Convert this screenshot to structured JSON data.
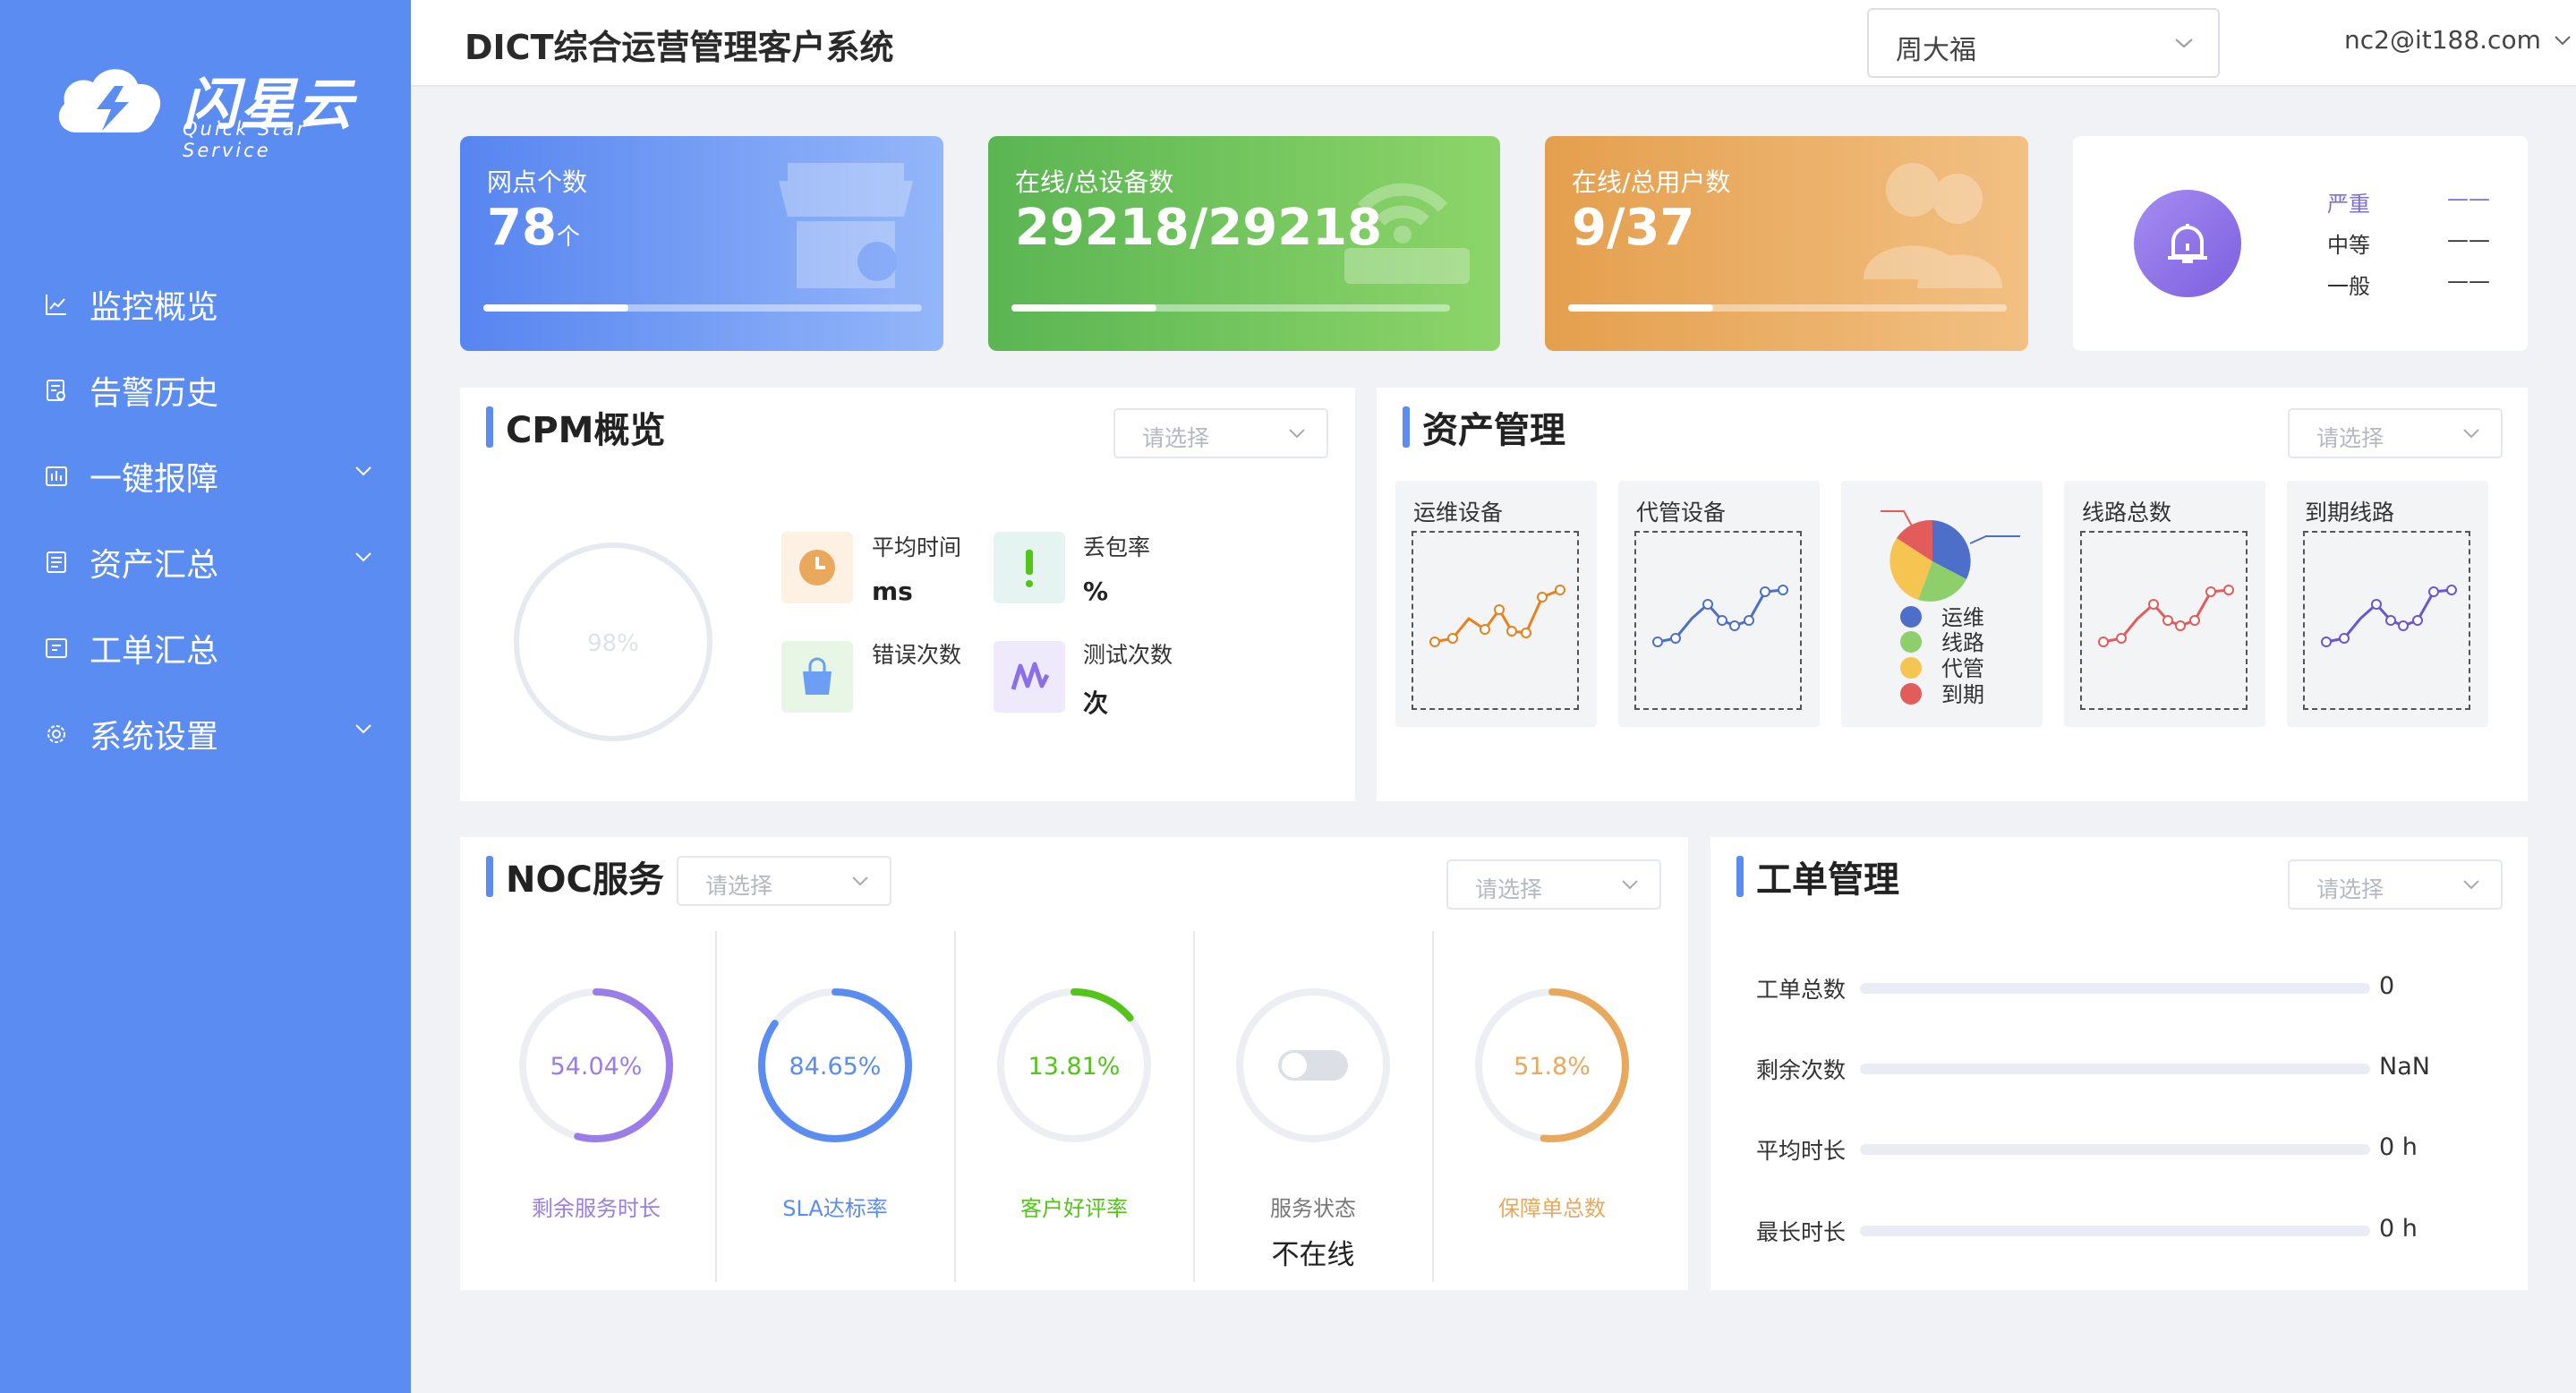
{
  "brand": {
    "name": "闪星云",
    "tagline": "Quick Star Service"
  },
  "header": {
    "title": "DICT综合运营管理客户系统",
    "store": "周大福",
    "user": "nc2@it188.com"
  },
  "sidebar": {
    "items": [
      {
        "label": "监控概览",
        "icon": "line-chart-icon"
      },
      {
        "label": "告警历史",
        "icon": "document-icon"
      },
      {
        "label": "一键报障",
        "icon": "report-icon"
      },
      {
        "label": "资产汇总",
        "icon": "list-icon"
      },
      {
        "label": "工单汇总",
        "icon": "ticket-icon"
      },
      {
        "label": "系统设置",
        "icon": "gear-icon"
      }
    ]
  },
  "stats": {
    "sites": {
      "label": "网点个数",
      "value": "78",
      "unit": "个",
      "progress": 0.33
    },
    "devices": {
      "label": "在线/总设备数",
      "value": "29218/29218",
      "progress": 0.33
    },
    "users": {
      "label": "在线/总用户数",
      "value": "9/37",
      "progress": 0.33
    }
  },
  "alarm": {
    "levels": [
      {
        "label": "严重",
        "value": "——"
      },
      {
        "label": "中等",
        "value": "——"
      },
      {
        "label": "一般",
        "value": "——"
      }
    ]
  },
  "cpm": {
    "title": "CPM概览",
    "select_placeholder": "请选择",
    "ring_value": "98%",
    "metrics": {
      "avg_time": {
        "label": "平均时间",
        "value": "ms"
      },
      "packet_loss": {
        "label": "丢包率",
        "value": "%"
      },
      "errors": {
        "label": "错误次数",
        "value": ""
      },
      "tests": {
        "label": "测试次数",
        "value": "次"
      }
    }
  },
  "assets": {
    "title": "资产管理",
    "select_placeholder": "请选择",
    "boxes": [
      "运维设备",
      "代管设备",
      "线路总数",
      "到期线路"
    ],
    "legend": [
      {
        "label": "运维",
        "color": "#4e6fc9"
      },
      {
        "label": "线路",
        "color": "#8ecf6c"
      },
      {
        "label": "代管",
        "color": "#f5c451"
      },
      {
        "label": "到期",
        "color": "#e25c5c"
      }
    ]
  },
  "noc": {
    "title": "NOC服务",
    "select1_placeholder": "请选择",
    "select2_placeholder": "请选择",
    "gauges": [
      {
        "value": "54.04%",
        "label": "剩余服务时长",
        "color": "#9a7de8",
        "pct": 0.5404
      },
      {
        "value": "84.65%",
        "label": "SLA达标率",
        "color": "#5b8cf2",
        "pct": 0.8465
      },
      {
        "value": "13.81%",
        "label": "客户好评率",
        "color": "#52c41a",
        "pct": 0.1381
      },
      {
        "label": "服务状态",
        "status": "不在线"
      },
      {
        "value": "51.8%",
        "label": "保障单总数",
        "color": "#e8a95c",
        "pct": 0.518
      }
    ]
  },
  "workorder": {
    "title": "工单管理",
    "select_placeholder": "请选择",
    "rows": [
      {
        "label": "工单总数",
        "value": "0"
      },
      {
        "label": "剩余次数",
        "value": "NaN"
      },
      {
        "label": "平均时长",
        "value": "0 h"
      },
      {
        "label": "最长时长",
        "value": "0 h"
      }
    ]
  }
}
